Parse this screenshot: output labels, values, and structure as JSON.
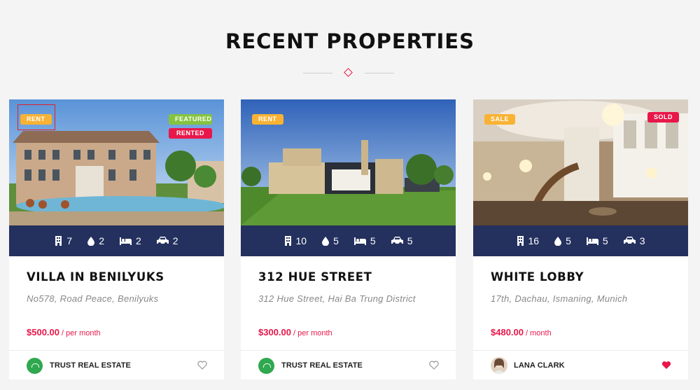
{
  "section": {
    "title": "RECENT PROPERTIES"
  },
  "properties": [
    {
      "badges": [
        "RENT",
        "FEATURED",
        "RENTED"
      ],
      "stats": {
        "rooms": "7",
        "baths": "2",
        "beds": "2",
        "garages": "2"
      },
      "title": "VILLA IN BENILYUKS",
      "address": "No578, Road Peace, Benilyuks",
      "price": "$500.00",
      "price_unit": "/ per month",
      "agent": "TRUST REAL ESTATE",
      "favorited": false
    },
    {
      "badges": [
        "RENT"
      ],
      "stats": {
        "rooms": "10",
        "baths": "5",
        "beds": "5",
        "garages": "5"
      },
      "title": "312 HUE STREET",
      "address": "312 Hue Street, Hai Ba Trung District",
      "price": "$300.00",
      "price_unit": "/ per month",
      "agent": "TRUST REAL ESTATE",
      "favorited": false
    },
    {
      "badges": [
        "SALE",
        "SOLD"
      ],
      "stats": {
        "rooms": "16",
        "baths": "5",
        "beds": "5",
        "garages": "3"
      },
      "title": "WHITE LOBBY",
      "address": "17th, Dachau, Ismaning, Munich",
      "price": "$480.00",
      "price_unit": "/ month",
      "agent": "LANA CLARK",
      "favorited": true
    }
  ],
  "colors": {
    "accent": "#e8174a",
    "stats_bar": "#24305e",
    "badge_rent": "#f9b233",
    "badge_featured": "#84c33f"
  }
}
